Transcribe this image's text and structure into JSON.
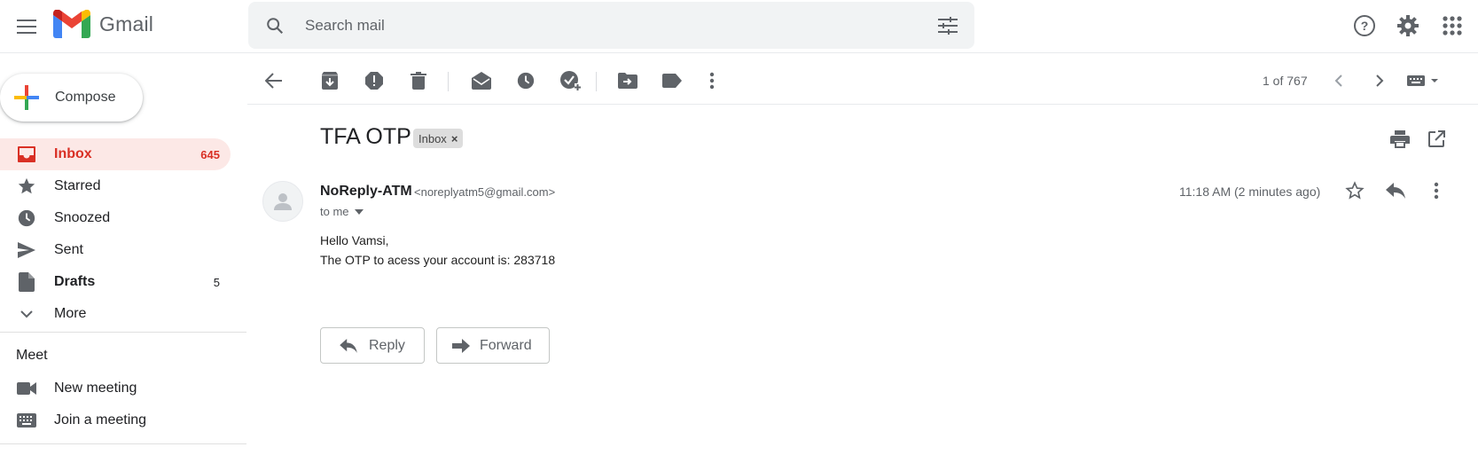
{
  "app": {
    "logo_text": "Gmail"
  },
  "search": {
    "placeholder": "Search mail"
  },
  "compose": {
    "label": "Compose"
  },
  "sidebar": {
    "items": [
      {
        "label": "Inbox",
        "count": "645"
      },
      {
        "label": "Starred",
        "count": ""
      },
      {
        "label": "Snoozed",
        "count": ""
      },
      {
        "label": "Sent",
        "count": ""
      },
      {
        "label": "Drafts",
        "count": "5"
      },
      {
        "label": "More",
        "count": ""
      }
    ],
    "meet": {
      "title": "Meet",
      "items": [
        {
          "label": "New meeting"
        },
        {
          "label": "Join a meeting"
        }
      ]
    }
  },
  "toolbar": {
    "pager": "1 of 767"
  },
  "message": {
    "subject": "TFA OTP",
    "label_chip": "Inbox",
    "chip_close": "×",
    "sender_name": "NoReply-ATM",
    "sender_email": "<noreplyatm5@gmail.com>",
    "recipient": "to me",
    "time": "11:18 AM (2 minutes ago)",
    "body": [
      "Hello Vamsi,",
      "The OTP to acess your account is: 283718"
    ]
  },
  "actions": {
    "reply": "Reply",
    "forward": "Forward"
  },
  "colors": {
    "accent": "#d93025",
    "active_bg": "#fce8e6",
    "icon": "#5f6368"
  }
}
